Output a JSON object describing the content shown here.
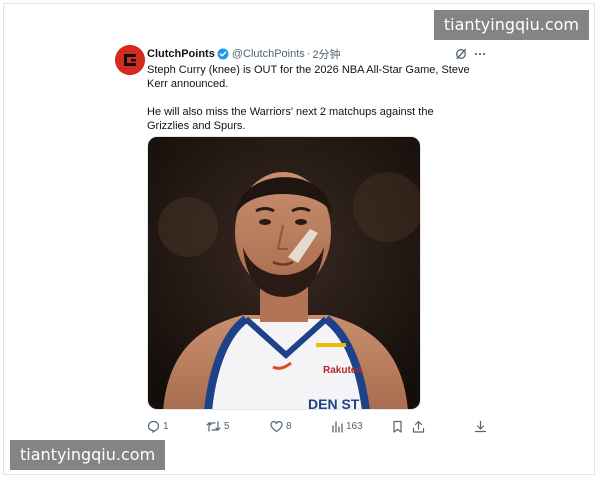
{
  "watermark": {
    "top": "tiantyingqiu.com",
    "bottom": "tiantyingqiu.com"
  },
  "post": {
    "author": {
      "name": "ClutchPoints",
      "handle": "@ClutchPoints",
      "avatar_icon": "clutchpoints-logo-icon",
      "verified": true
    },
    "separator": "·",
    "time": "2分钟",
    "text": [
      "Steph Curry (knee) is OUT for the 2026 NBA All-Star Game, Steve Kerr announced.",
      "He will also miss the Warriors' next 2 matchups against the Grizzlies and Spurs."
    ],
    "media": {
      "jersey_text": "DEN ST",
      "sponsor_text": "Rakuten"
    },
    "actions": {
      "replies": "1",
      "reposts": "5",
      "likes": "8",
      "views": "163"
    }
  },
  "icons": [
    "grok-icon",
    "more-icon",
    "reply-icon",
    "repost-icon",
    "like-icon",
    "views-icon",
    "bookmark-icon",
    "share-icon",
    "download-icon",
    "verified-badge-icon"
  ],
  "colors": {
    "verified": "#1d9bf0",
    "avatar_bg": "#d42a20",
    "secondary_text": "#536471"
  }
}
